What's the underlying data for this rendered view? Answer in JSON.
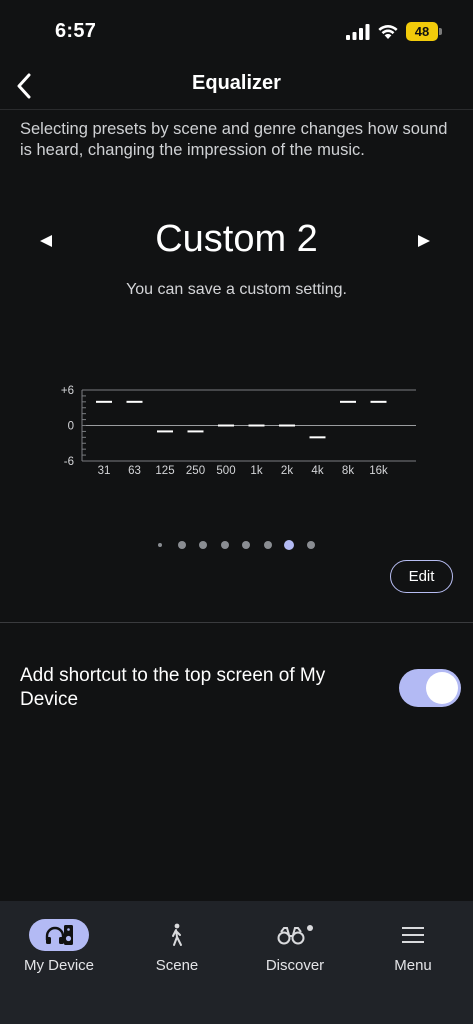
{
  "status": {
    "time": "6:57",
    "battery": "48"
  },
  "header": {
    "title": "Equalizer"
  },
  "description": "Selecting presets by scene and genre changes how sound is heard, changing the impression of the music.",
  "preset": {
    "name": "Custom 2",
    "subtitle": "You can save a custom setting."
  },
  "equalizer": {
    "y_labels": [
      "+6",
      "0",
      "-6"
    ],
    "range": [
      -6,
      6
    ],
    "bands": [
      "31",
      "63",
      "125",
      "250",
      "500",
      "1k",
      "2k",
      "4k",
      "8k",
      "16k"
    ],
    "values": [
      4,
      4,
      -1,
      -1,
      0,
      0,
      0,
      -2,
      4,
      4
    ]
  },
  "pagination": {
    "count": 8,
    "active": 7
  },
  "edit_label": "Edit",
  "shortcut": {
    "label": "Add shortcut to the top screen of My Device",
    "enabled": true
  },
  "tabs": [
    {
      "label": "My Device",
      "icon": "headphones-speaker-icon",
      "active": true
    },
    {
      "label": "Scene",
      "icon": "walking-person-icon",
      "active": false
    },
    {
      "label": "Discover",
      "icon": "binoculars-icon",
      "active": false
    },
    {
      "label": "Menu",
      "icon": "hamburger-menu-icon",
      "active": false
    }
  ],
  "colors": {
    "accent": "#b3baf4",
    "background": "#111213",
    "tabbar": "#202328",
    "battery": "#f2cb0b"
  }
}
